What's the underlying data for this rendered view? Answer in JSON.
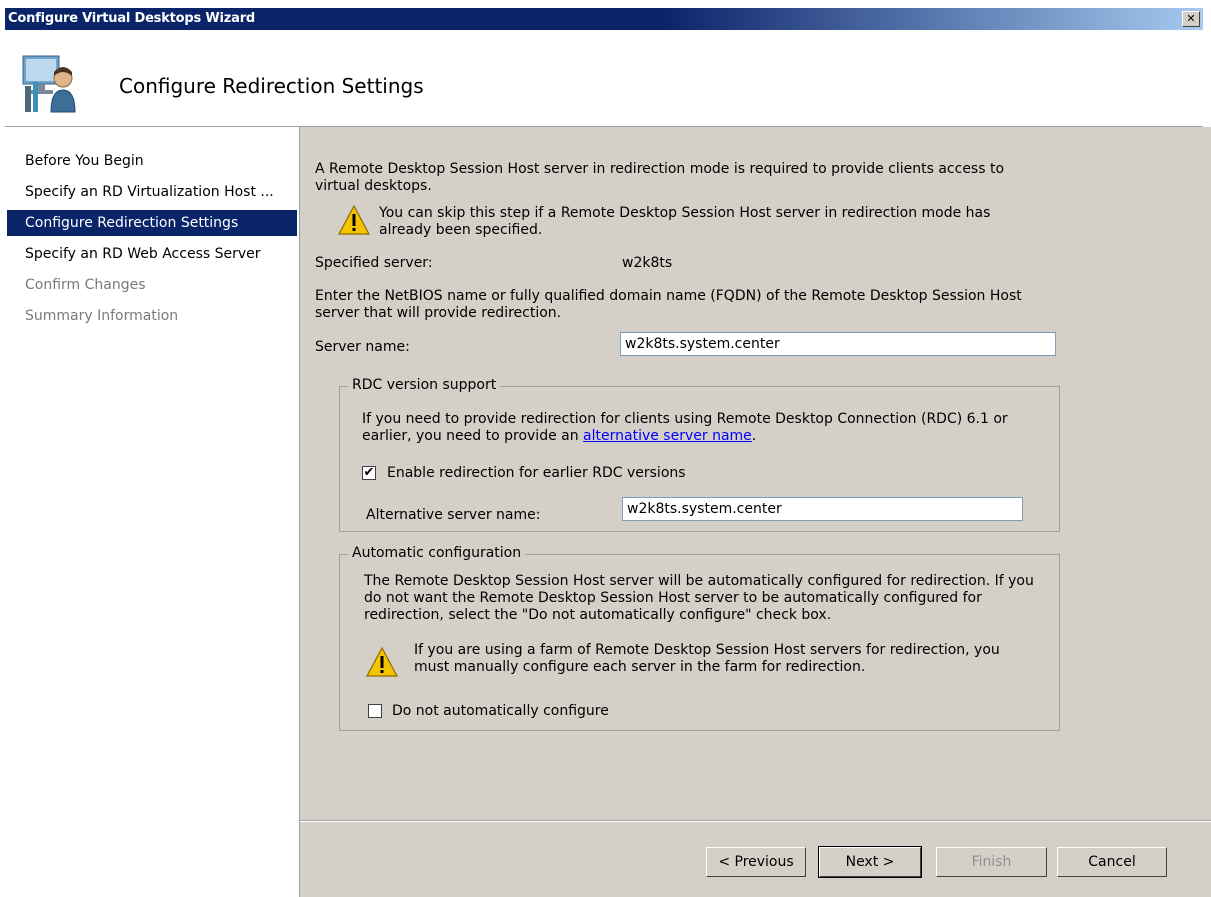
{
  "window": {
    "title": "Configure Virtual Desktops Wizard",
    "close_glyph": "✕"
  },
  "header": {
    "title": "Configure Redirection Settings",
    "icon": "wizard-user-icon"
  },
  "nav": {
    "items": [
      {
        "label": "Before You Begin",
        "state": "normal"
      },
      {
        "label": "Specify an RD Virtualization Host ...",
        "state": "normal"
      },
      {
        "label": "Configure Redirection Settings",
        "state": "active"
      },
      {
        "label": "Specify an RD Web Access Server",
        "state": "normal"
      },
      {
        "label": "Confirm Changes",
        "state": "disabled"
      },
      {
        "label": "Summary Information",
        "state": "disabled"
      }
    ]
  },
  "main": {
    "intro_line1": "A Remote Desktop Session Host server in redirection mode is required to provide clients access to",
    "intro_line2": "virtual desktops.",
    "warning1_line1": "You can skip this step if a Remote Desktop Session Host server in redirection mode has",
    "warning1_line2": "already been specified.",
    "specified_server_label": "Specified server:",
    "specified_server_value": "w2k8ts",
    "enter_line1": "Enter the NetBIOS name or fully qualified domain name (FQDN) of the Remote Desktop Session Host",
    "enter_line2": "server that will provide redirection.",
    "server_name_label": "Server name:",
    "server_name_value": "w2k8ts.system.center"
  },
  "rdc_group": {
    "label": "RDC version support",
    "text_line1": "If you need to provide redirection for clients using Remote Desktop Connection (RDC) 6.1 or",
    "text_line2_prefix": "earlier, you need to provide an ",
    "text_line2_link": "alternative server name",
    "text_line2_suffix": ".",
    "enable_checkbox_label": "Enable redirection for earlier RDC versions",
    "enable_checkbox_checked": true,
    "check_glyph": "✔",
    "alt_server_label": "Alternative server name:",
    "alt_server_value": "w2k8ts.system.center"
  },
  "auto_group": {
    "label": "Automatic configuration",
    "text_line1": "The Remote Desktop Session Host server will be automatically configured for redirection. If you",
    "text_line2": "do not want the Remote Desktop Session Host server to be automatically configured for",
    "text_line3": "redirection, select the \"Do not automatically configure\" check box.",
    "warning_line1": "If you are using a farm of Remote Desktop Session Host servers for redirection, you",
    "warning_line2": "must manually configure each server in the farm for redirection.",
    "dont_configure_label": "Do not automatically configure",
    "dont_configure_checked": false
  },
  "buttons": {
    "previous": "< Previous",
    "next": "Next >",
    "finish": "Finish",
    "cancel": "Cancel"
  },
  "colors": {
    "titlebar": "#0a246a",
    "selection": "#0a246a",
    "dialog_bg": "#d4d0c8",
    "link": "#0000ff"
  }
}
